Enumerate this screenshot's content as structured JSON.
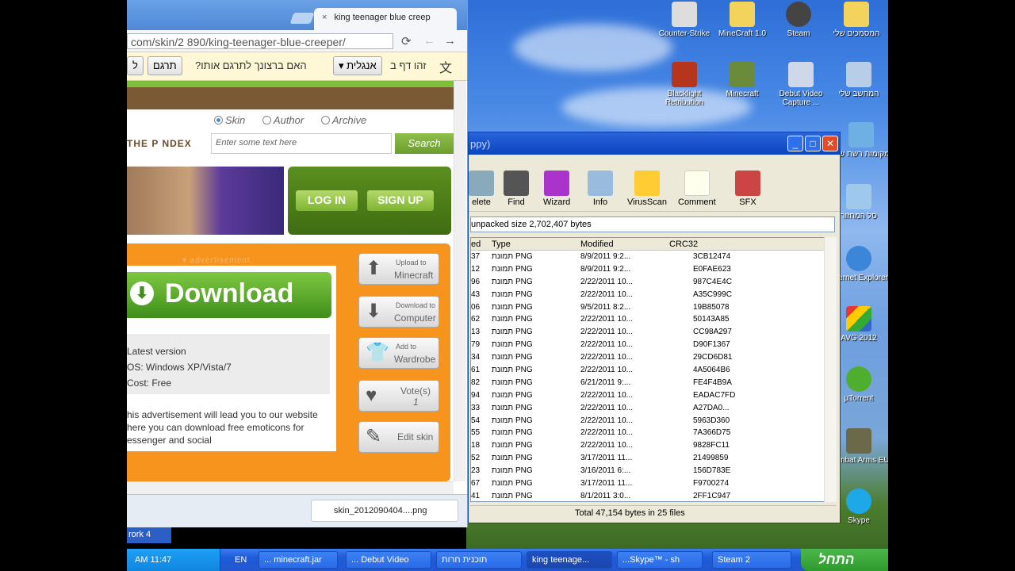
{
  "browser": {
    "tab_title": "king teenager blue creep",
    "tab_close": "×",
    "url": "com/skin/2  890/king-teenager-blue-creeper/",
    "translate": {
      "label_left": "ל",
      "translate_button": "תרגם",
      "question": "?האם ברצונך לתרגם אותו",
      "language_select": "אנגלית",
      "page_is": "זהו דף ב"
    }
  },
  "page": {
    "radios": {
      "skin": "Skin",
      "author": "Author",
      "archive": "Archive"
    },
    "logo": "THE P NDEX",
    "search_placeholder": "Enter some text here",
    "search_button": "Search",
    "login": "LOG IN",
    "signup": "SIGN UP",
    "ad_label": "▾ advertisement",
    "download": "Download",
    "ad_info": [
      "Latest version",
      "OS: Windows XP/Vista/7",
      "Cost: Free"
    ],
    "ad_text": "his advertisement will lead you to our website here you can download free emoticons for essenger and social",
    "side_buttons": [
      {
        "small": "Upload to",
        "big": "Minecraft"
      },
      {
        "small": "Download to",
        "big": "Computer"
      },
      {
        "small": "Add to",
        "big": "Wardrobe"
      },
      {
        "small": "",
        "big": "Vote(s)",
        "count": "1"
      },
      {
        "small": "",
        "big": "Edit skin"
      }
    ]
  },
  "download_bar": {
    "file": "skin_2012090404....png"
  },
  "desktop_icons": [
    {
      "label": "Counter-Strike"
    },
    {
      "label": "MineCraft 1.0"
    },
    {
      "label": "Steam"
    },
    {
      "label": "המסמכים שלי"
    },
    {
      "label": "Blacklight Retribution"
    },
    {
      "label": "Minecraft"
    },
    {
      "label": "Debut Video Capture ..."
    },
    {
      "label": "המחשב שלי"
    },
    {
      "label": "מקומות רשת שלי"
    },
    {
      "label": "סל המחזור"
    },
    {
      "label": "Internet Explorer"
    },
    {
      "label": "AVG 2012"
    },
    {
      "label": "µTorrent"
    },
    {
      "label": "Combat Arms EU"
    },
    {
      "label": "Skype"
    }
  ],
  "winrar": {
    "title": "ppy)",
    "toolbar": [
      "elete",
      "Find",
      "Wizard",
      "Info",
      "VirusScan",
      "Comment",
      "SFX"
    ],
    "path": "unpacked size 2,702,407 bytes",
    "headers": [
      "ed",
      "Type",
      "Modified",
      "CRC32"
    ],
    "rows": [
      [
        "37",
        "תמונת PNG",
        "8/9/2011 9:2...",
        "3CB12474"
      ],
      [
        "12",
        "תמונת PNG",
        "8/9/2011 9:2...",
        "E0FAE623"
      ],
      [
        "96",
        "תמונת PNG",
        "2/22/2011 10...",
        "987C4E4C"
      ],
      [
        "43",
        "תמונת PNG",
        "2/22/2011 10...",
        "A35C999C"
      ],
      [
        "06",
        "תמונת PNG",
        "9/5/2011 8:2...",
        "19B85078"
      ],
      [
        "62",
        "תמונת PNG",
        "2/22/2011 10...",
        "50143A85"
      ],
      [
        "13",
        "תמונת PNG",
        "2/22/2011 10...",
        "CC98A297"
      ],
      [
        "79",
        "תמונת PNG",
        "2/22/2011 10...",
        "D90F1367"
      ],
      [
        "34",
        "תמונת PNG",
        "2/22/2011 10...",
        "29CD6D81"
      ],
      [
        "61",
        "תמונת PNG",
        "2/22/2011 10...",
        "4A5064B6"
      ],
      [
        "82",
        "תמונת PNG",
        "6/21/2011 9:...",
        "FE4F4B9A"
      ],
      [
        "94",
        "תמונת PNG",
        "2/22/2011 10...",
        "EADAC7FD"
      ],
      [
        "33",
        "תמונת PNG",
        "2/22/2011 10...",
        "A27DA0..."
      ],
      [
        "54",
        "תמונת PNG",
        "2/22/2011 10...",
        "5963D360"
      ],
      [
        "55",
        "תמונת PNG",
        "2/22/2011 10...",
        "7A366D75"
      ],
      [
        "18",
        "תמונת PNG",
        "2/22/2011 10...",
        "9828FC11"
      ],
      [
        "52",
        "תמונת PNG",
        "3/17/2011 11...",
        "21499859"
      ],
      [
        "23",
        "תמונת PNG",
        "3/16/2011 6:...",
        "156D783E"
      ],
      [
        "67",
        "תמונת PNG",
        "3/17/2011 11...",
        "F9700274"
      ],
      [
        "41",
        "תמונת PNG",
        "8/1/2011 3:0...",
        "2FF1C947"
      ]
    ],
    "status": "Total 47,154 bytes in 25 files"
  },
  "overlay_small": "rork 4",
  "taskbar": {
    "clock": "AM 11:47",
    "lang": "EN",
    "tasks": [
      "... minecraft.jar",
      "... Debut Video",
      "תוכנית חרות",
      "king teenage...",
      "...Skype™ - sh",
      "Steam 2"
    ],
    "start": "התחל"
  }
}
